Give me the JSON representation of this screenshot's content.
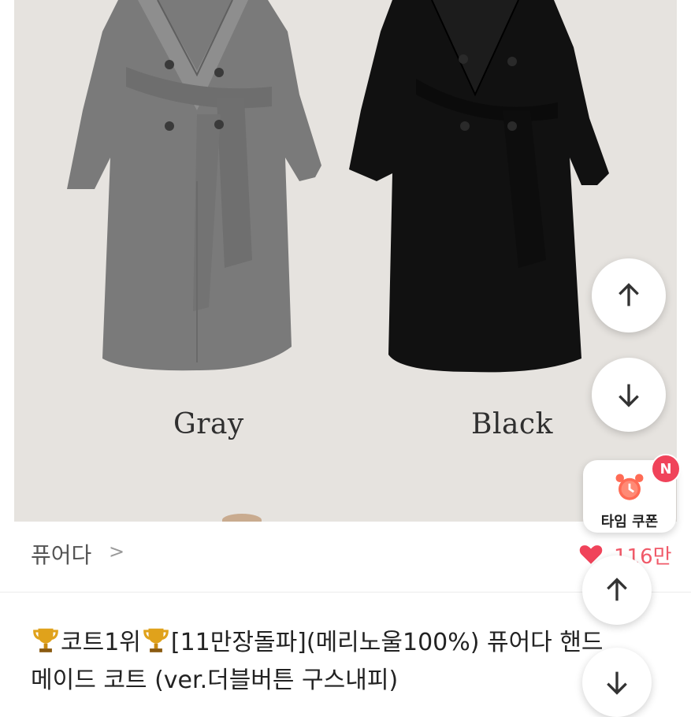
{
  "product_image": {
    "left_color_label": "Gray",
    "right_color_label": "Black",
    "colors": {
      "gray_coat": "#7d7d7d",
      "black_coat": "#111111",
      "background": "#e6e3df"
    }
  },
  "store": {
    "name": "퓨어다",
    "chevron": ">",
    "likes": "116만",
    "heart_color": "#f0435a"
  },
  "product": {
    "title_line1_rank": "코트1위",
    "title_line1_rest": "[11만장돌파](메리노울100%) 퓨어다 핸드",
    "title_line2": "메이드 코트 (ver.더블버튼 구스내피)"
  },
  "floating": {
    "coupon_label": "타임 쿠폰",
    "coupon_badge": "N",
    "scroll_up_icon": "arrow-up-icon",
    "scroll_down_icon": "arrow-down-icon"
  }
}
